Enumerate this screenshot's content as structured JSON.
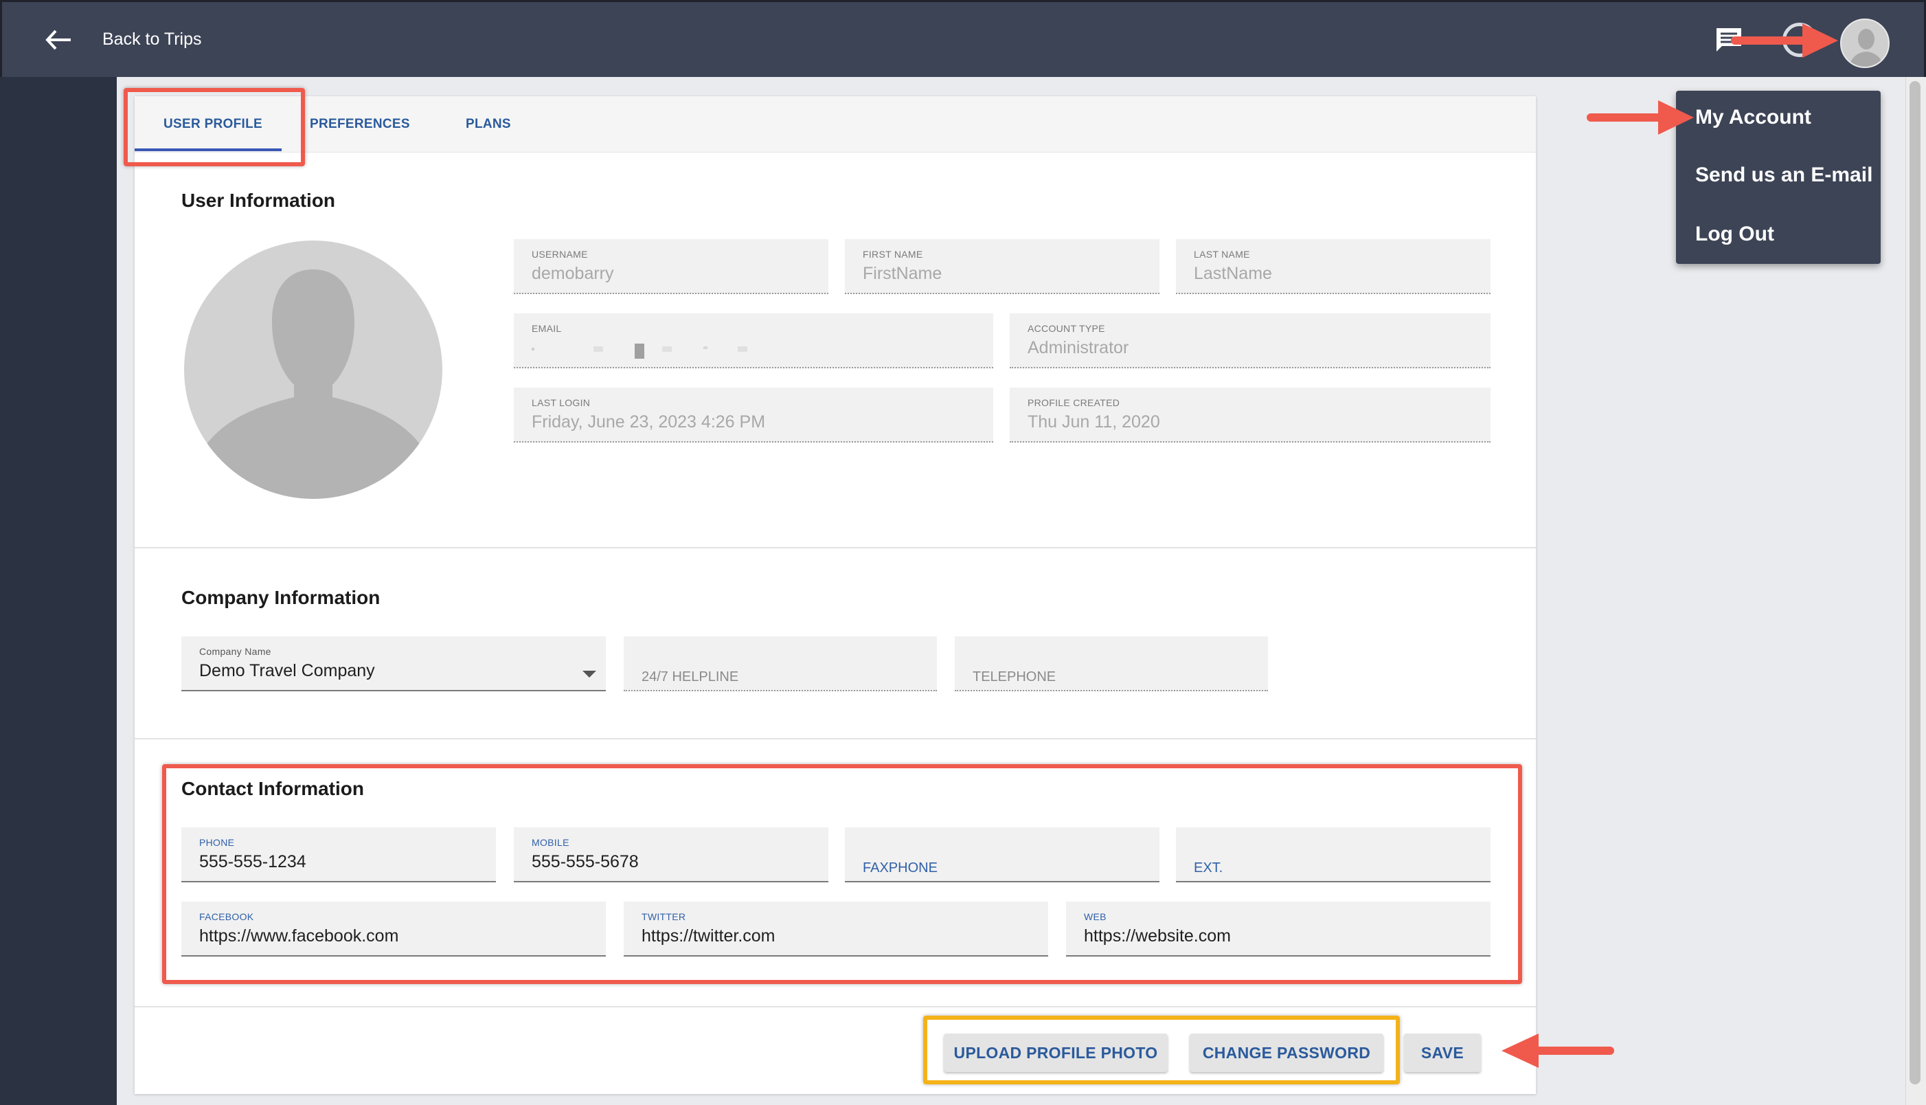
{
  "header": {
    "back_label": "Back to Trips"
  },
  "tabs": [
    {
      "label": "USER PROFILE",
      "active": true
    },
    {
      "label": "PREFERENCES",
      "active": false
    },
    {
      "label": "PLANS",
      "active": false
    }
  ],
  "user_info": {
    "title": "User Information",
    "username": {
      "label": "USERNAME",
      "value": "demobarry"
    },
    "first_name": {
      "label": "FIRST NAME",
      "value": "FirstName"
    },
    "last_name": {
      "label": "LAST NAME",
      "value": "LastName"
    },
    "email": {
      "label": "EMAIL",
      "value": ""
    },
    "account_type": {
      "label": "ACCOUNT TYPE",
      "value": "Administrator"
    },
    "last_login": {
      "label": "LAST LOGIN",
      "value": "Friday, June 23, 2023 4:26 PM"
    },
    "profile_created": {
      "label": "PROFILE CREATED",
      "value": "Thu Jun 11, 2020"
    }
  },
  "company_info": {
    "title": "Company Information",
    "company_name": {
      "label": "Company Name",
      "value": "Demo Travel Company"
    },
    "helpline": {
      "label": "24/7 HELPLINE"
    },
    "telephone": {
      "label": "TELEPHONE"
    }
  },
  "contact_info": {
    "title": "Contact Information",
    "phone": {
      "label": "PHONE",
      "value": "555-555-1234"
    },
    "mobile": {
      "label": "MOBILE",
      "value": "555-555-5678"
    },
    "faxphone": {
      "label": "FAXPHONE"
    },
    "ext": {
      "label": "EXT."
    },
    "facebook": {
      "label": "FACEBOOK",
      "value": "https://www.facebook.com"
    },
    "twitter": {
      "label": "TWITTER",
      "value": "https://twitter.com"
    },
    "web": {
      "label": "WEB",
      "value": "https://website.com"
    }
  },
  "actions": {
    "upload_photo": "UPLOAD PROFILE PHOTO",
    "change_password": "CHANGE PASSWORD",
    "save": "SAVE"
  },
  "account_menu": {
    "items": [
      "My Account",
      "Send us an E-mail",
      "Log Out"
    ]
  },
  "colors": {
    "header_bg": "#3d4456",
    "accent_blue": "#2a5a9c",
    "annotation_red": "#ef5a4d",
    "annotation_yellow": "#f4b21a"
  }
}
